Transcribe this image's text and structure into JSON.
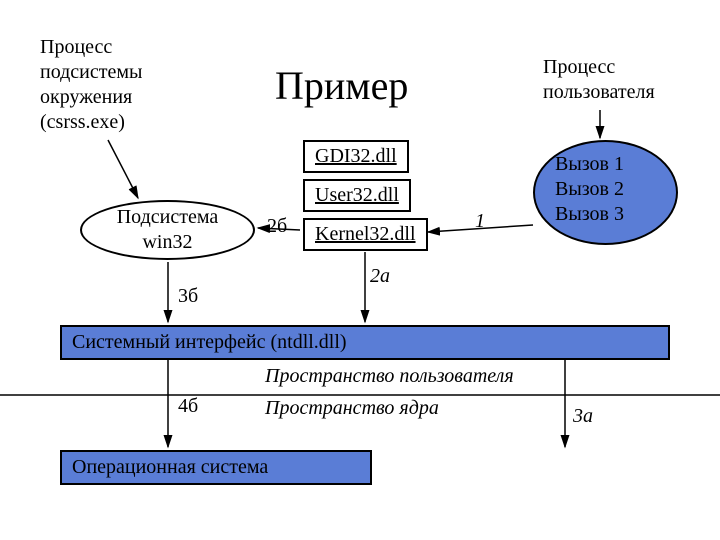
{
  "title": "Пример",
  "labels": {
    "csrss": "Процесс\nподсистемы\nокружения\n(csrss.exe)",
    "userProcess": "Процесс\nпользователя",
    "win32": "Подсистема\nwin32",
    "calls": "Вызов 1\nВызов 2\nВызов 3"
  },
  "dlls": {
    "gdi": "GDI32.dll",
    "user": "User32.dll",
    "kernel": "Kernel32.dll"
  },
  "bars": {
    "ntdll": "Системный интерфейс (ntdll.dll)",
    "os": "Операционная система"
  },
  "divider": {
    "top": "Пространство пользователя",
    "bottom": "Пространство ядра"
  },
  "steps": {
    "s1": "1",
    "s2a": "2а",
    "s2b": "2б",
    "s3a": "3а",
    "s3b": "3б",
    "s4b": "4б"
  }
}
